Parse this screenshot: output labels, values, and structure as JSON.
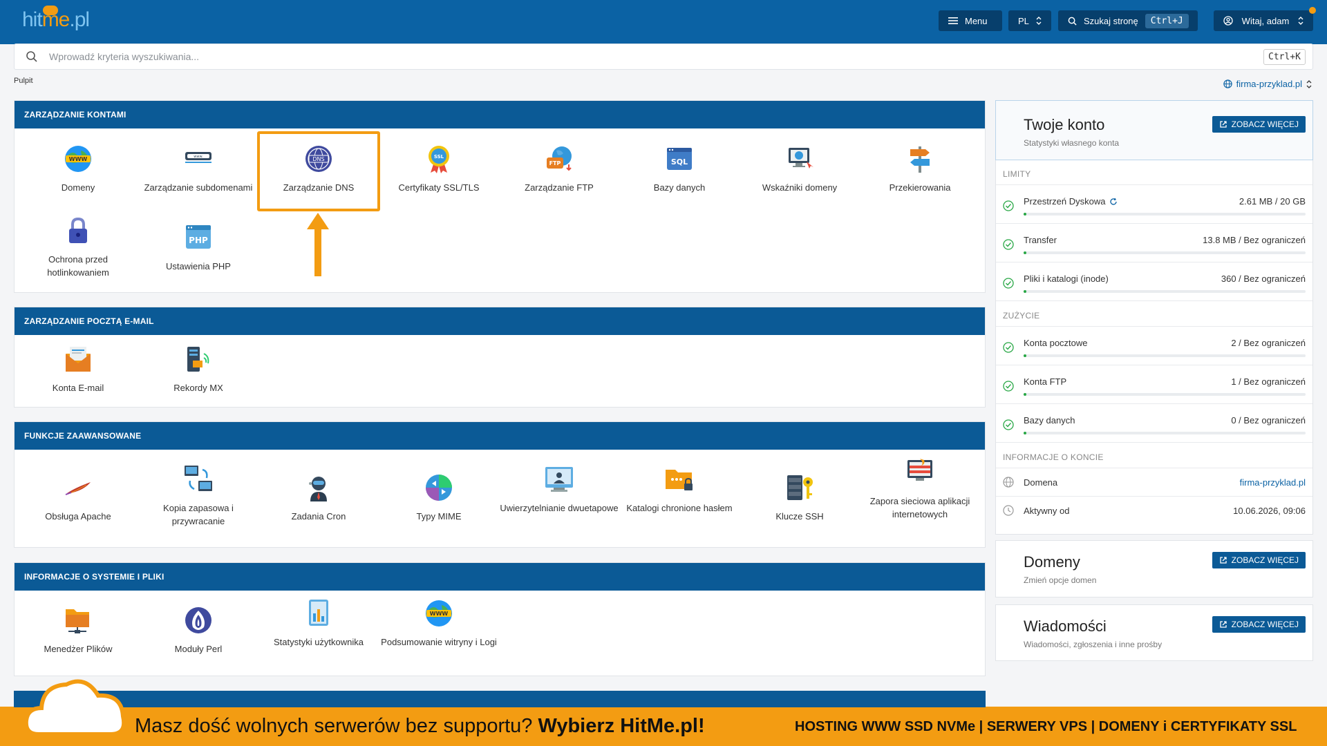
{
  "header": {
    "logo_prefix": "hit",
    "logo_mid": "me",
    "logo_suffix": ".pl",
    "menu_label": "Menu",
    "lang_label": "PL",
    "search_page_label": "Szukaj stronę",
    "search_page_shortcut": "Ctrl+J",
    "user_label": "Witaj, adam"
  },
  "search": {
    "placeholder": "Wprowadź kryteria wyszukiwania...",
    "shortcut": "Ctrl+K"
  },
  "breadcrumb": "Pulpit",
  "domain_selector": "firma-przyklad.pl",
  "sections": [
    {
      "title": "ZARZĄDZANIE KONTAMI",
      "items": [
        "Domeny",
        "Zarządzanie subdomenami",
        "Zarządzanie DNS",
        "Certyfikaty SSL/TLS",
        "Zarządzanie FTP",
        "Bazy danych",
        "Wskaźniki domeny",
        "Przekierowania",
        "Ochrona przed hotlinkowaniem",
        "Ustawienia PHP"
      ]
    },
    {
      "title": "ZARZĄDZANIE POCZTĄ E-MAIL",
      "items": [
        "Konta E-mail",
        "Rekordy MX"
      ]
    },
    {
      "title": "FUNKCJE ZAAWANSOWANE",
      "items": [
        "Obsługa Apache",
        "Kopia zapasowa i przywracanie",
        "Zadania Cron",
        "Typy MIME",
        "Uwierzytelnianie dwuetapowe",
        "Katalogi chronione hasłem",
        "Klucze SSH",
        "Zapora sieciowa aplikacji internetowych"
      ]
    },
    {
      "title": "INFORMACJE O SYSTEMIE I PLIKI",
      "items": [
        "Menedżer Plików",
        "Moduły Perl",
        "Statystyki użytkownika",
        "Podsumowanie witryny i Logi"
      ]
    }
  ],
  "account_card": {
    "title": "Twoje konto",
    "subtitle": "Statystyki własnego konta",
    "see_more": "ZOBACZ WIĘCEJ",
    "limits_title": "LIMITY",
    "limits": [
      {
        "label": "Przestrzeń Dyskowa",
        "value": "2.61 MB / 20 GB",
        "fraction": 0.01
      },
      {
        "label": "Transfer",
        "value": "13.8 MB / Bez ograniczeń",
        "fraction": 0.01
      },
      {
        "label": "Pliki i katalogi (inode)",
        "value": "360 / Bez ograniczeń",
        "fraction": 0.01
      }
    ],
    "usage_title": "ZUŻYCIE",
    "usage": [
      {
        "label": "Konta pocztowe",
        "value": "2 / Bez ograniczeń",
        "fraction": 0.01
      },
      {
        "label": "Konta FTP",
        "value": "1 / Bez ograniczeń",
        "fraction": 0.01
      },
      {
        "label": "Bazy danych",
        "value": "0 / Bez ograniczeń",
        "fraction": 0.01
      }
    ],
    "info_title": "INFORMACJE O KONCIE",
    "info": [
      {
        "label": "Domena",
        "value": "firma-przyklad.pl"
      },
      {
        "label": "Aktywny od",
        "value": "10.06.2026, 09:06"
      }
    ]
  },
  "domains_card": {
    "title": "Domeny",
    "subtitle": "Zmień opcje domen",
    "see_more": "ZOBACZ WIĘCEJ"
  },
  "messages_card": {
    "title": "Wiadomości",
    "subtitle": "Wiadomości, zgłoszenia i inne prośby",
    "see_more": "ZOBACZ WIĘCEJ"
  },
  "banner": {
    "text_normal": "Masz dość wolnych serwerów bez supportu? ",
    "text_bold": "Wybierz HitMe.pl!",
    "text_right": "HOSTING WWW SSD NVMe | SERWERY VPS | DOMENY i CERTYFIKATY SSL"
  },
  "colors": {
    "primary": "#0b62a4",
    "section_head": "#0b5a96",
    "accent": "#f39c12",
    "ok": "#28a745"
  }
}
